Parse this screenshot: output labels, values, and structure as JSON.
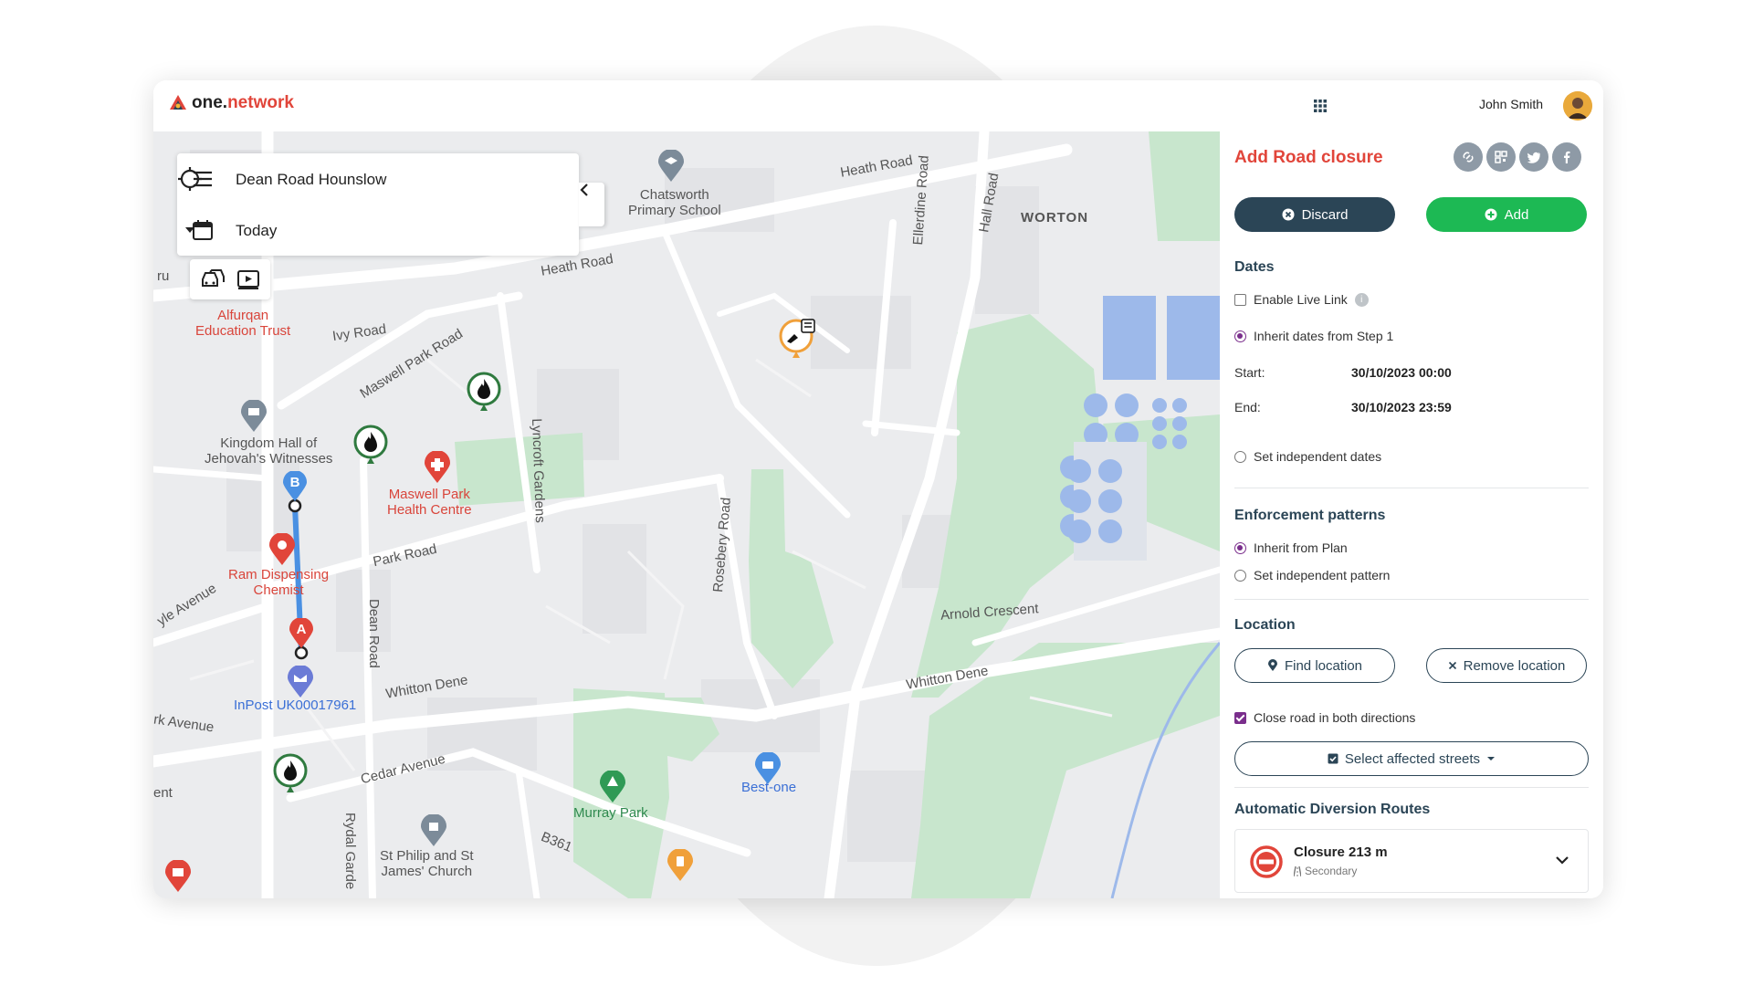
{
  "app": {
    "logo_prefix": "one.",
    "logo_suffix": "network"
  },
  "user": {
    "name": "John Smith"
  },
  "search": {
    "location": "Dean Road Hounslow",
    "date": "Today"
  },
  "map_labels": {
    "heath_road_1": "Heath Road",
    "heath_road_2": "Heath Road",
    "worton": "WORTON",
    "ivy_road": "Ivy Road",
    "maswell_park_road": "Maswell Park Road",
    "lyncroft_gardens": "Lyncroft Gardens",
    "ellerdine_road": "Ellerdine Road",
    "hall_road": "Hall Road",
    "park_road": "Park Road",
    "rosebery_road": "Rosebery Road",
    "dean_road": "Dean Road",
    "arnold_crescent": "Arnold Crescent",
    "whitton_dene_1": "Whitton Dene",
    "whitton_dene_2": "Whitton Dene",
    "cedar_avenue": "Cedar Avenue",
    "b361": "B361",
    "rydal_gardens": "Rydal Garde",
    "avenue_left": "yle Avenue",
    "rk_avenue": "rk Avenue",
    "ent": "ent",
    "ru": "ru"
  },
  "poi_labels": {
    "chatsworth": "Chatsworth\nPrimary School",
    "alfurqan": "Alfurqan\nEducation Trust",
    "kingdom_hall": "Kingdom Hall of\nJehovah's Witnesses",
    "maswell_health": "Maswell Park\nHealth Centre",
    "ram_chemist": "Ram Dispensing\nChemist",
    "inpost": "InPost UK00017961",
    "best_one": "Best-one",
    "murray_park": "Murray Park",
    "st_philip": "St Philip and St\nJames' Church"
  },
  "route_markers": {
    "a": "A",
    "b": "B"
  },
  "panel": {
    "title": "Add Road closure",
    "discard_label": "Discard",
    "add_label": "Add",
    "dates": {
      "title": "Dates",
      "live_link": "Enable Live Link",
      "inherit": "Inherit dates from Step 1",
      "start_label": "Start:",
      "start_value": "30/10/2023 00:00",
      "end_label": "End:",
      "end_value": "30/10/2023 23:59",
      "independent": "Set independent dates"
    },
    "enforcement": {
      "title": "Enforcement patterns",
      "inherit": "Inherit from Plan",
      "independent": "Set independent pattern"
    },
    "location": {
      "title": "Location",
      "find": "Find location",
      "remove": "Remove location",
      "close_both": "Close road in both directions",
      "select_streets": "Select affected streets"
    },
    "diversion": {
      "title": "Automatic Diversion Routes",
      "closure_title": "Closure 213 m",
      "closure_sub": "Secondary"
    }
  },
  "colors": {
    "accent_red": "#e1453a",
    "navy": "#2b4556",
    "green": "#1db954",
    "purple": "#7a2e8c",
    "route_blue": "#4a90e2"
  }
}
